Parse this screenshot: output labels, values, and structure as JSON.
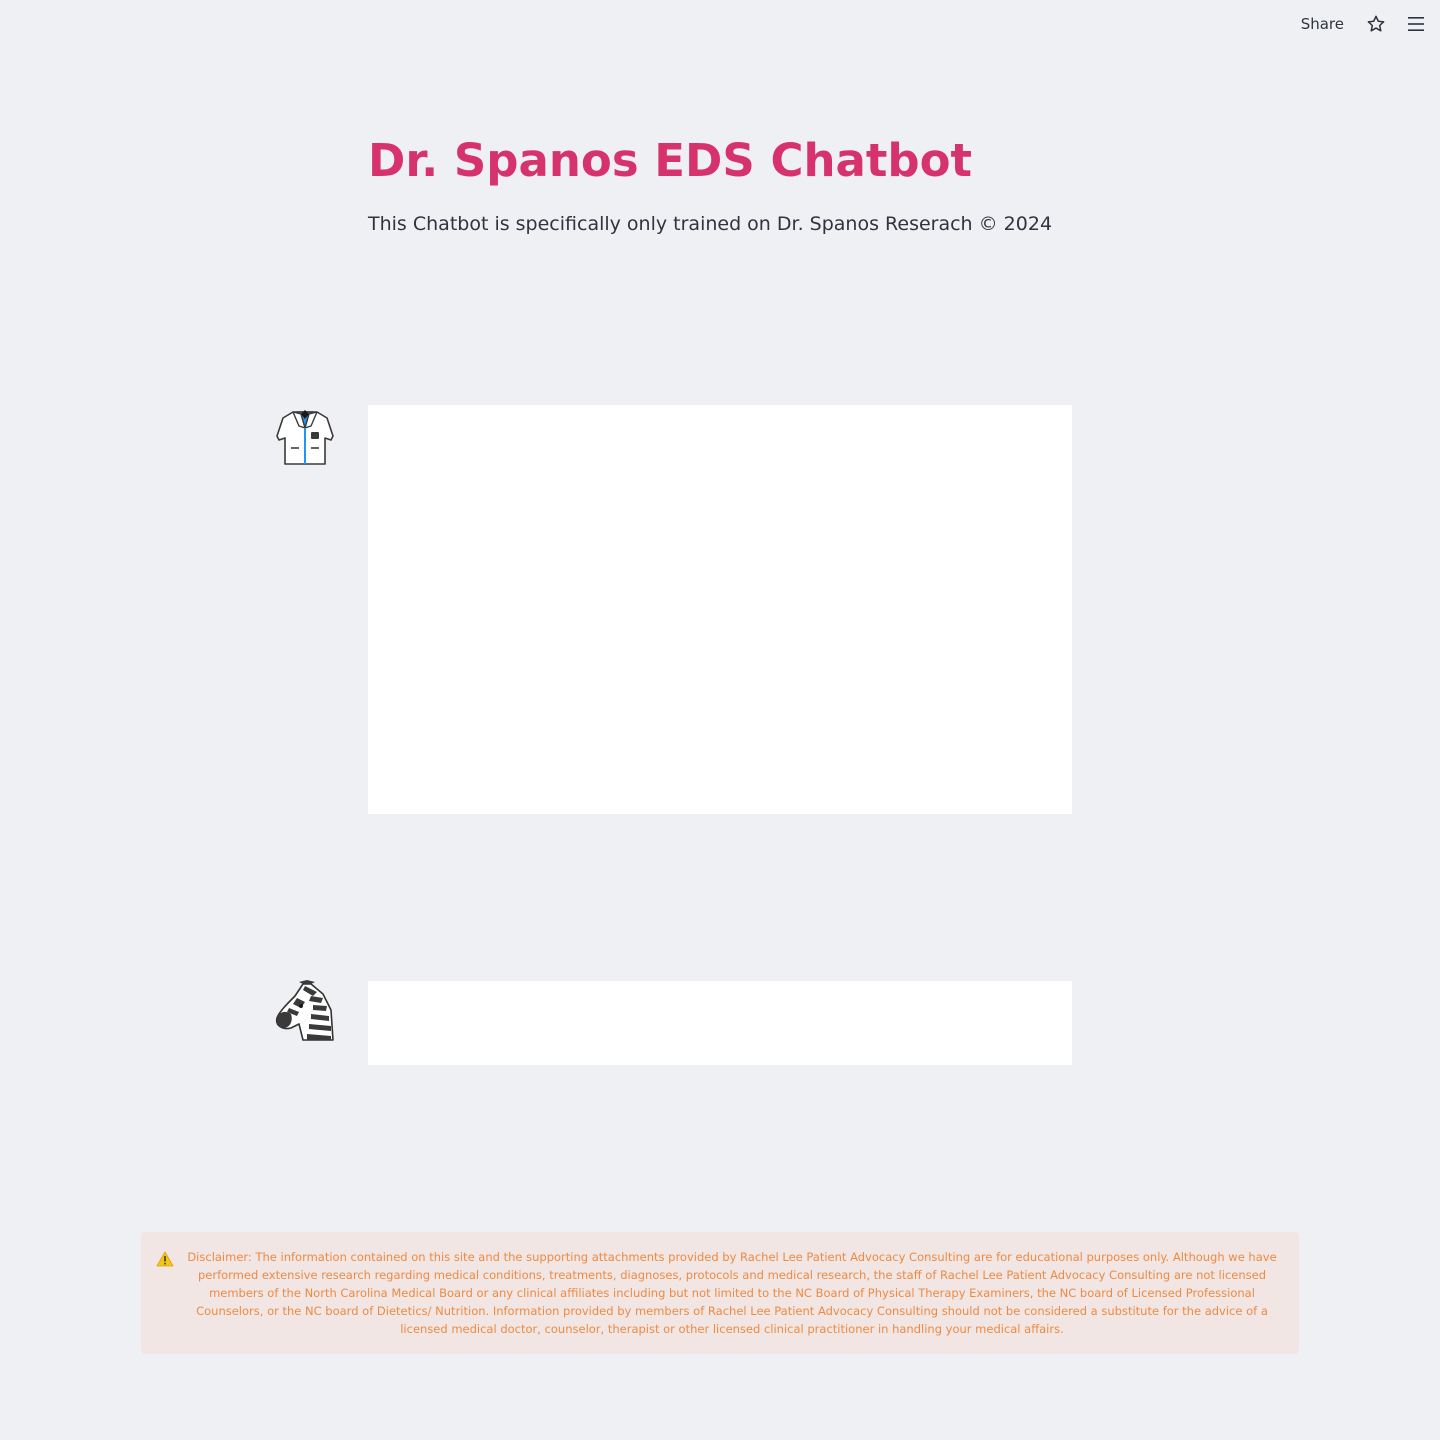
{
  "toolbar": {
    "share_label": "Share",
    "star_icon": "star-icon",
    "menu_icon": "hamburger-menu-icon"
  },
  "header": {
    "title": "Dr. Spanos EDS Chatbot",
    "subtitle": "This Chatbot is specifically only trained on Dr. Spanos Reserach © 2024"
  },
  "chat": {
    "messages": [
      {
        "avatar": "doctor-coat-icon",
        "role": "assistant",
        "content": ""
      },
      {
        "avatar": "zebra-icon",
        "role": "user",
        "content": ""
      }
    ]
  },
  "disclaimer": {
    "icon": "warning-icon",
    "text": "Disclaimer: The information contained on this site and the supporting attachments provided by Rachel Lee Patient Advocacy Consulting are for educational purposes only. Although we have performed extensive research regarding medical conditions, treatments, diagnoses, protocols and medical research, the staff of Rachel Lee Patient Advocacy Consulting are not licensed members of the North Carolina Medical Board or any clinical affiliates including but not limited to the NC Board of Physical Therapy Examiners, the NC board of Licensed Professional Counselors, or the NC board of Dietetics/ Nutrition. Information provided by members of Rachel Lee Patient Advocacy Consulting should not be considered a substitute for the advice of a licensed medical doctor, counselor, therapist or other licensed clinical practitioner in handling your medical affairs."
  },
  "colors": {
    "background": "#eef0f4",
    "title": "#d6336c",
    "text": "#31333f",
    "panel": "#ffffff",
    "disclaimer_bg": "#f1e6e3",
    "disclaimer_text": "#ee8a43"
  }
}
